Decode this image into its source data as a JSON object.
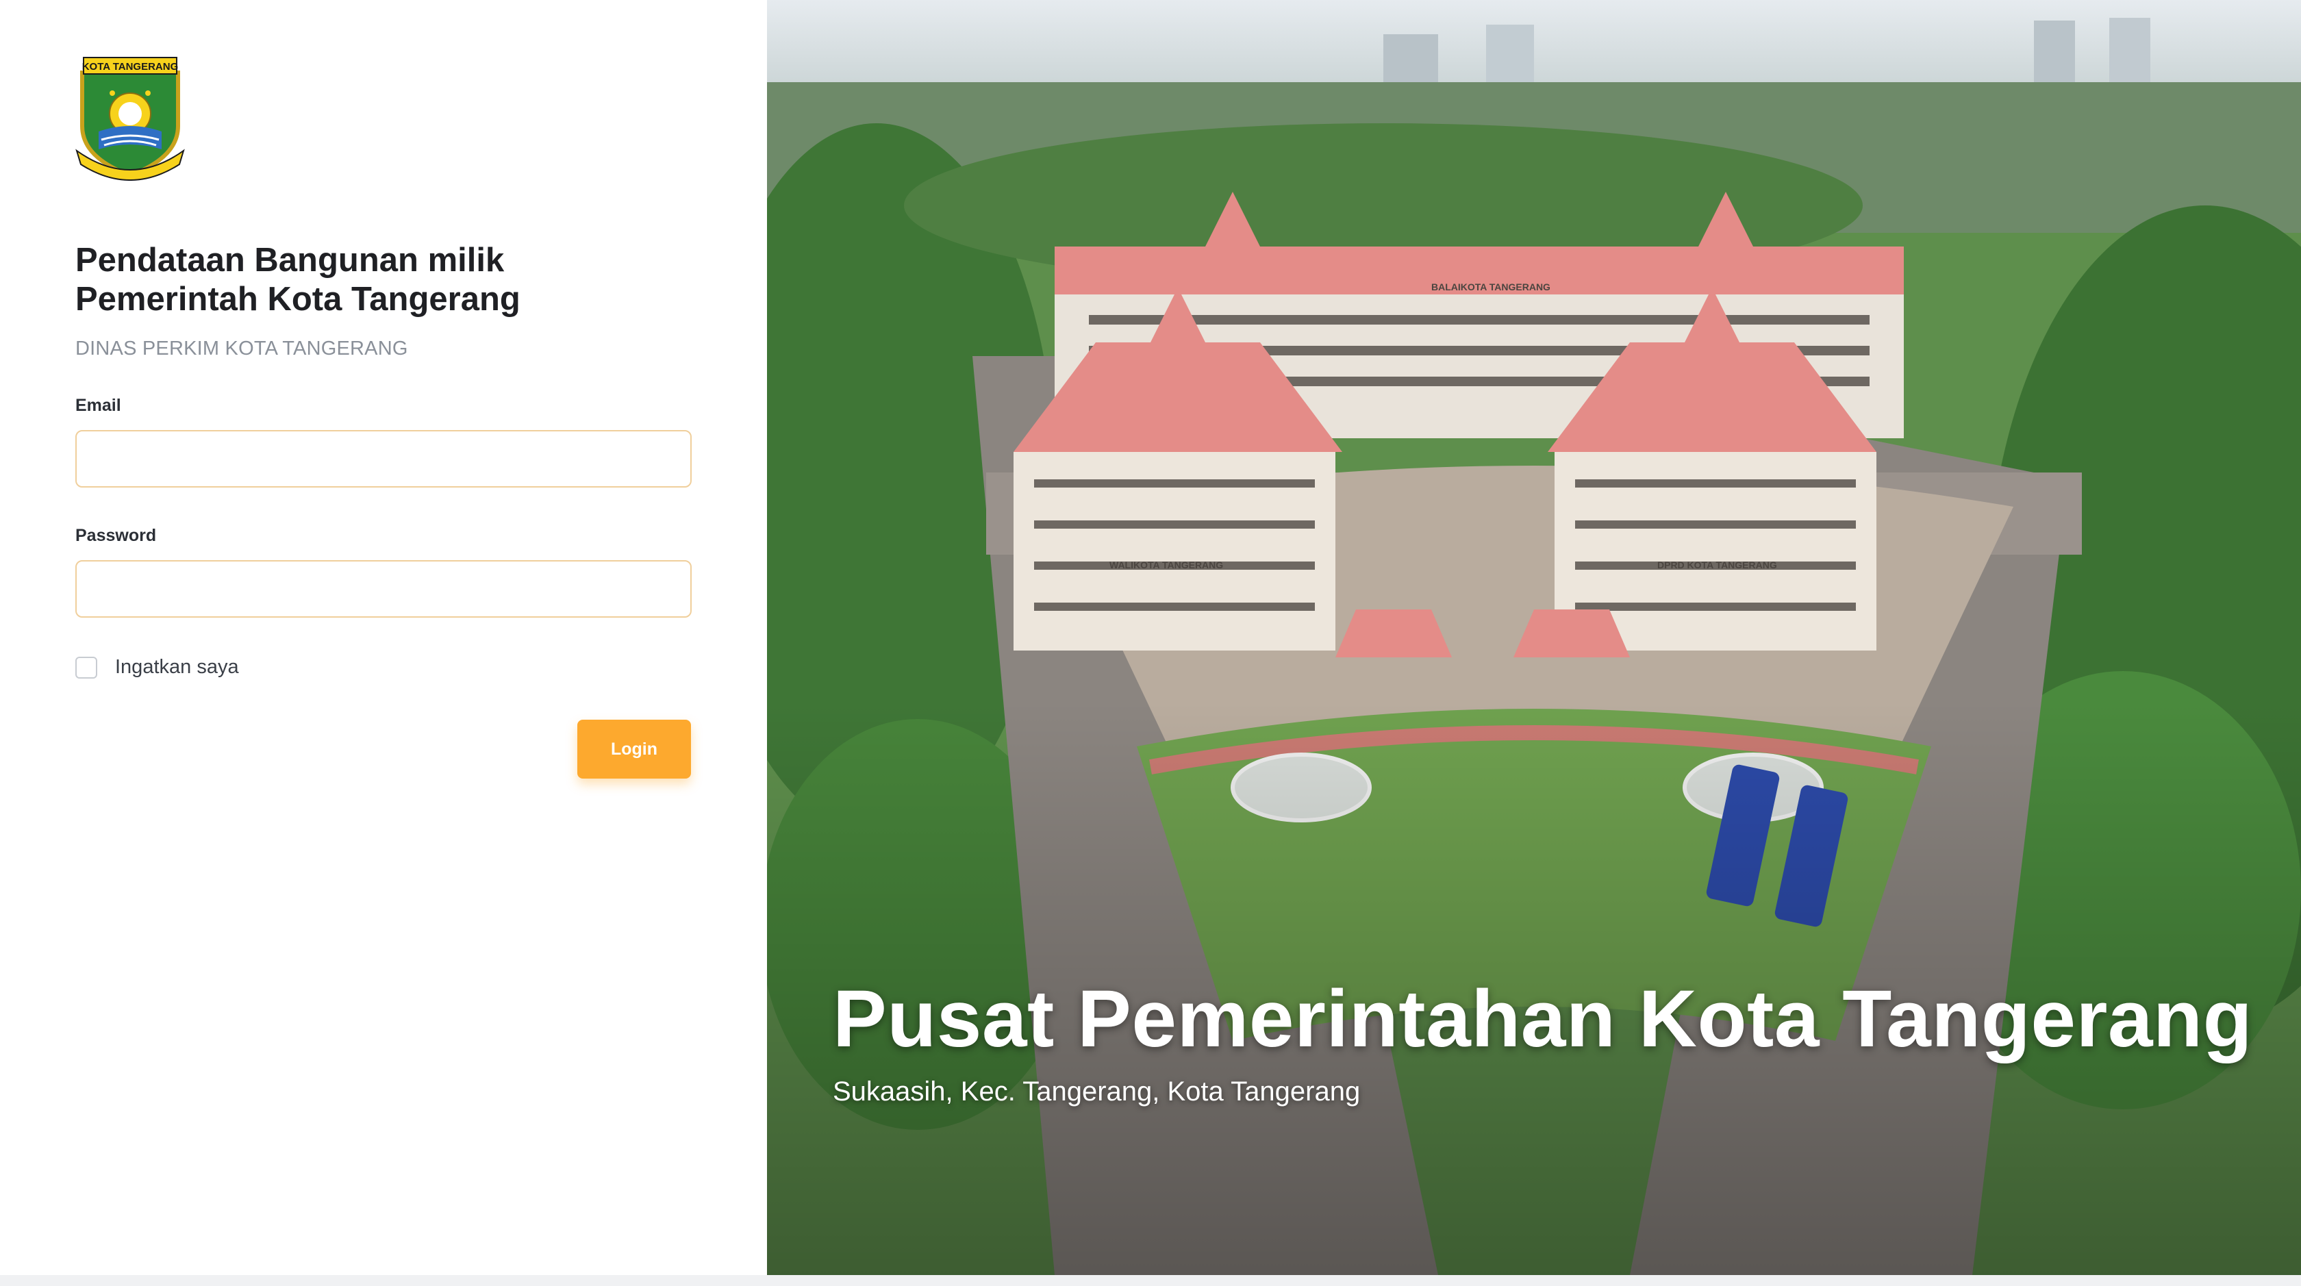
{
  "header": {
    "title": "Pendataan Bangunan milik Pemerintah Kota Tangerang",
    "subtitle": "DINAS PERKIM KOTA TANGERANG",
    "logo_text": "KOTA TANGERANG"
  },
  "form": {
    "email_label": "Email",
    "email_value": "",
    "email_placeholder": "",
    "password_label": "Password",
    "password_value": "",
    "password_placeholder": "",
    "remember_label": "Ingatkan saya",
    "remember_checked": false,
    "login_label": "Login"
  },
  "hero": {
    "title": "Pusat Pemerintahan Kota Tangerang",
    "subtitle": "Sukaasih, Kec. Tangerang, Kota Tangerang",
    "building_signs": [
      "BALAIKOTA TANGERANG",
      "WALIKOTA TANGERANG",
      "DPRD KOTA TANGERANG"
    ]
  },
  "colors": {
    "accent": "#fda92e",
    "input_border": "#f0cf9c",
    "roof": "#e48c88",
    "lawn": "#6fa14f"
  }
}
